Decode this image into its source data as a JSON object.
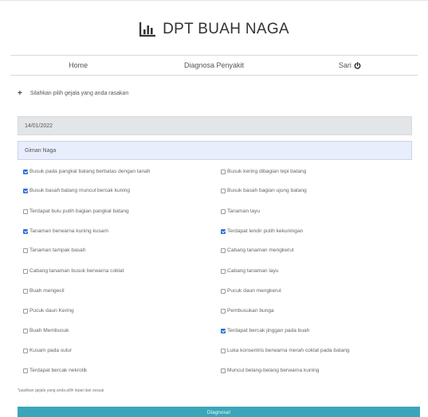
{
  "app": {
    "title": "DPT BUAH NAGA",
    "logo_icon": "bar-chart-icon"
  },
  "nav": {
    "items": [
      {
        "label": "Home"
      },
      {
        "label": "Diagnosa Penyakit"
      },
      {
        "label": "Sari",
        "icon": "power-icon"
      }
    ]
  },
  "form": {
    "prompt": "Silahkan pilih gejala yang anda rasakan",
    "date_value": "14/01/2022",
    "name_value": "Giman Naga",
    "symptoms": [
      {
        "label": "Busuk pada pangkal batang berbatas dengan tanah",
        "checked": true
      },
      {
        "label": "Busuk kering dibagian tepi batang",
        "checked": false
      },
      {
        "label": "Busuk basah batang muncul bercak kuning",
        "checked": true
      },
      {
        "label": "Busuk basah bagian ujung batang",
        "checked": false
      },
      {
        "label": "Terdapat bulu putih bagian pangkal batang",
        "checked": false
      },
      {
        "label": "Tanaman layu",
        "checked": false
      },
      {
        "label": "Tanaman berwarna kuning kusam",
        "checked": true
      },
      {
        "label": "Terdapat lendir putih kekuningan",
        "checked": true
      },
      {
        "label": "Tanaman tampak basah",
        "checked": false
      },
      {
        "label": "Cabang tanaman mengkerut",
        "checked": false
      },
      {
        "label": "Cabang tanaman busuk berwarna coklat",
        "checked": false
      },
      {
        "label": "Cabang tanaman layu",
        "checked": false
      },
      {
        "label": "Buah mengecil",
        "checked": false
      },
      {
        "label": "Pucuk daun mengkerut",
        "checked": false
      },
      {
        "label": "Pucuk daun Kering",
        "checked": false
      },
      {
        "label": "Pembusukan bunga",
        "checked": false
      },
      {
        "label": "Buah Membusuk",
        "checked": false
      },
      {
        "label": "Terdapat bercak jinggan pada buah",
        "checked": true
      },
      {
        "label": "Kusam pada sulur",
        "checked": false
      },
      {
        "label": "Luka konsentris berwarna merah coklat pada batang",
        "checked": false
      },
      {
        "label": "Terdapat bercak nekrotik",
        "checked": false
      },
      {
        "label": "Muncul belang-belang berwarna kuning",
        "checked": false
      }
    ],
    "note": "*pastikan gejala yang anda pilih tepat dan sesuai",
    "submit_label": "Diagnosa!"
  },
  "colors": {
    "accent": "#3aa6b9",
    "checkbox": "#2a6fd6",
    "date_bg": "#e3e6e9",
    "name_bg": "#e8eefb"
  }
}
